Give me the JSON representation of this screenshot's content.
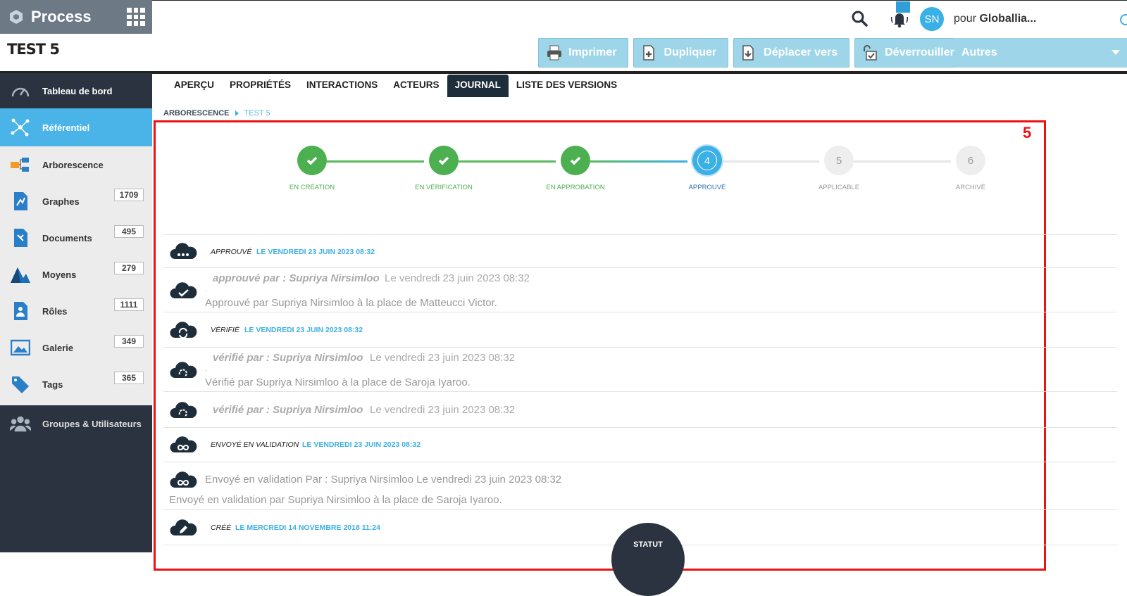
{
  "app": {
    "name": "Process",
    "document_title": "TEST 5"
  },
  "header": {
    "avatar_initials": "SN",
    "pour_prefix": "pour ",
    "pour_org": "Globallia..."
  },
  "toolbar": {
    "imprimer": "Imprimer",
    "dupliquer": "Dupliquer",
    "deplacer": "Déplacer vers",
    "deverrouiller": "Déverrouiller",
    "autres": "Autres"
  },
  "sidebar": {
    "dashboard": "Tableau de bord",
    "referentiel": "Référentiel",
    "items": [
      {
        "label": "Arborescence",
        "count": ""
      },
      {
        "label": "Graphes",
        "count": "1709"
      },
      {
        "label": "Documents",
        "count": "495"
      },
      {
        "label": "Moyens",
        "count": "279"
      },
      {
        "label": "Rôles",
        "count": "1111"
      },
      {
        "label": "Galerie",
        "count": "349"
      },
      {
        "label": "Tags",
        "count": "365"
      }
    ],
    "groups": "Groupes & Utilisateurs"
  },
  "tabs": [
    "APERÇU",
    "PROPRIÉTÉS",
    "INTERACTIONS",
    "ACTEURS",
    "JOURNAL",
    "LISTE DES VERSIONS"
  ],
  "breadcrumb": {
    "root": "ARBORESCENCE",
    "current": "TEST 5"
  },
  "annotation_number": "5",
  "steps": [
    {
      "label": "EN CRÉATION",
      "state": "done"
    },
    {
      "label": "EN VÉRIFICATION",
      "state": "done"
    },
    {
      "label": "EN APPROBATION",
      "state": "done"
    },
    {
      "label": "APPROUVÉ",
      "state": "current",
      "number": "4"
    },
    {
      "label": "APPLICABLE",
      "state": "todo",
      "number": "5"
    },
    {
      "label": "ARCHIVÉ",
      "state": "todo",
      "number": "6"
    }
  ],
  "journal": {
    "e1": {
      "title": "APPROUVÉ",
      "date": "LE VENDREDI 23 JUIN 2023 08:32"
    },
    "e2": {
      "title": "approuvé par : Supriya Nirsimloo",
      "date": "Le vendredi 23 juin 2023 08:32",
      "dot": ".",
      "desc": "Approuvé par Supriya Nirsimloo à la place de Matteucci Victor."
    },
    "e3": {
      "title": "VÉRIFIÉ",
      "date": "LE VENDREDI 23 JUIN 2023 08:32"
    },
    "e4": {
      "title": "vérifié par : Supriya Nirsimloo",
      "date": "Le vendredi 23 juin 2023 08:32",
      "dot": ".",
      "desc": "Vérifié par Supriya Nirsimloo à la place de Saroja Iyaroo."
    },
    "e5": {
      "title": "vérifié par : Supriya Nirsimloo",
      "date": "Le vendredi 23 juin 2023 08:32"
    },
    "e6": {
      "title": "ENVOYÉ EN VALIDATION",
      "date": "LE VENDREDI 23 JUIN 2023 08:32"
    },
    "e7": {
      "text": "Envoyé en validation Par : Supriya Nirsimloo Le vendredi 23 juin 2023 08:32",
      "desc": "Envoyé en validation par Supriya Nirsimloo à la place de Saroja Iyaroo."
    },
    "e8": {
      "title": "CRÉÉ",
      "date": "LE MERCREDI 14 NOVEMBRE 2018 11:24"
    }
  },
  "statut_label": "STATUT",
  "colors": {
    "accent": "#3ab0e6",
    "done": "#4caf50",
    "sidebar": "#2b3340",
    "annotation": "#ee1111"
  }
}
